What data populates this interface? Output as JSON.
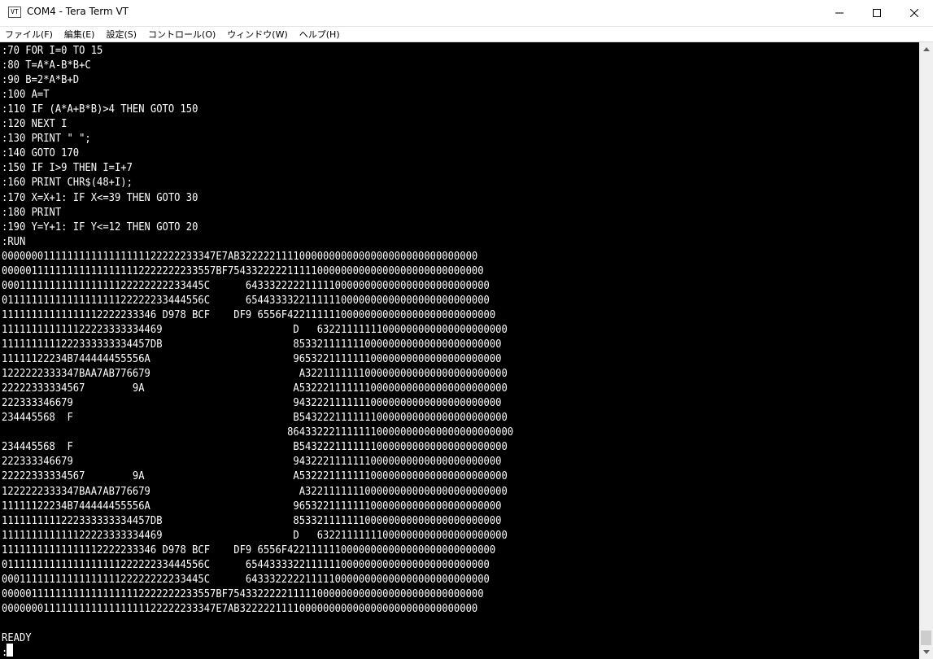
{
  "window": {
    "title": "COM4 - Tera Term VT",
    "app_icon_label": "VT",
    "icons": {
      "minimize": "minimize-icon",
      "maximize": "maximize-icon",
      "close": "close-icon"
    }
  },
  "menu": {
    "items": [
      {
        "label": "ファイル(F)"
      },
      {
        "label": "編集(E)"
      },
      {
        "label": "設定(S)"
      },
      {
        "label": "コントロール(O)"
      },
      {
        "label": "ウィンドウ(W)"
      },
      {
        "label": "ヘルプ(H)"
      }
    ]
  },
  "terminal": {
    "lines": [
      ":70 FOR I=0 TO 15",
      ":80 T=A*A-B*B+C",
      ":90 B=2*A*B+D",
      ":100 A=T",
      ":110 IF (A*A+B*B)>4 THEN GOTO 150",
      ":120 NEXT I",
      ":130 PRINT \" \";",
      ":140 GOTO 170",
      ":150 IF I>9 THEN I=I+7",
      ":160 PRINT CHR$(48+I);",
      ":170 X=X+1: IF X<=39 THEN GOTO 30",
      ":180 PRINT",
      ":190 Y=Y+1: IF Y<=12 THEN GOTO 20",
      ":RUN",
      "000000011111111111111111122222233347E7AB3222221111000000000000000000000000000000",
      "000001111111111111111112222222233557BF7543322222111110000000000000000000000000000",
      "0001111111111111111122222222233445C      64333222221111100000000000000000000000000",
      "0111111111111111111122222233444556C      65443333221111110000000000000000000000000",
      "11111111111111112222233346 D978 BCF    DF9 6556F42211111100000000000000000000000000",
      "111111111111122223333334469                      D   63221111111000000000000000000000",
      "1111111111222333333334457DB                      85332111111100000000000000000000000",
      "11111122234B744444455556A                        96532211111110000000000000000000000",
      "1222222333347BAA7AB776679                         A3221111111000000000000000000000000",
      "22222333334567        9A                         A53222111111100000000000000000000000",
      "222333346679                                     94322211111110000000000000000000000",
      "234445568  F                                     B54322211111110000000000000000000000",
      "                                                86433222111111100000000000000000000000",
      "234445568  F                                     B54322211111110000000000000000000000",
      "222333346679                                     94322211111110000000000000000000000",
      "22222333334567        9A                         A53222111111100000000000000000000000",
      "1222222333347BAA7AB776679                         A3221111111000000000000000000000000",
      "11111122234B744444455556A                        96532211111110000000000000000000000",
      "1111111111222333333334457DB                      85332111111100000000000000000000000",
      "111111111111122223333334469                      D   63221111111000000000000000000000",
      "11111111111111112222233346 D978 BCF    DF9 6556F42211111100000000000000000000000000",
      "0111111111111111111122222233444556C      65443333221111110000000000000000000000000",
      "0001111111111111111122222222233445C      64333222221111100000000000000000000000000",
      "000001111111111111111112222222233557BF7543322222111110000000000000000000000000000",
      "000000011111111111111111122222233347E7AB3222221111000000000000000000000000000000",
      "",
      "READY",
      ":"
    ]
  },
  "scrollbar": {
    "up_icon": "scroll-up-arrow-icon",
    "down_icon": "scroll-down-arrow-icon"
  }
}
